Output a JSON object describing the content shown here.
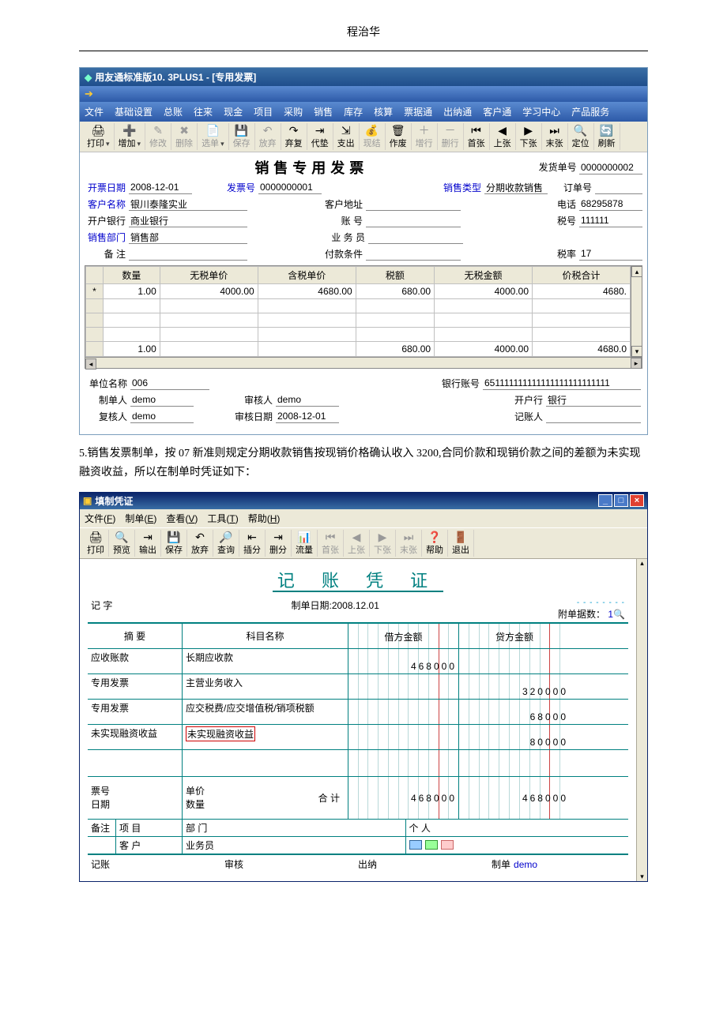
{
  "doc_header": "程治华",
  "win1": {
    "title": "用友通标准版10. 3PLUS1 - [专用发票]",
    "menu": [
      "文件",
      "基础设置",
      "总账",
      "往来",
      "现金",
      "项目",
      "采购",
      "销售",
      "库存",
      "核算",
      "票据通",
      "出纳通",
      "客户通",
      "学习中心",
      "产品服务"
    ],
    "toolbar": [
      {
        "id": "print",
        "label": "打印",
        "icon": "🖨",
        "enabled": true,
        "drop": true
      },
      {
        "id": "add",
        "label": "增加",
        "icon": "➕",
        "enabled": true,
        "drop": true
      },
      {
        "id": "edit",
        "label": "修改",
        "icon": "✎",
        "enabled": false
      },
      {
        "id": "del",
        "label": "删除",
        "icon": "✖",
        "enabled": false
      },
      {
        "id": "copy",
        "label": "选单",
        "icon": "📄",
        "enabled": false,
        "drop": true
      },
      {
        "id": "save",
        "label": "保存",
        "icon": "💾",
        "enabled": false
      },
      {
        "id": "undo",
        "label": "放弃",
        "icon": "↶",
        "enabled": false
      },
      {
        "id": "abandon",
        "label": "弃复",
        "icon": "↷",
        "enabled": true
      },
      {
        "id": "advance",
        "label": "代垫",
        "icon": "⇥",
        "enabled": true
      },
      {
        "id": "out",
        "label": "支出",
        "icon": "⇲",
        "enabled": true
      },
      {
        "id": "cash",
        "label": "现结",
        "icon": "💰",
        "enabled": false
      },
      {
        "id": "void",
        "label": "作废",
        "icon": "🗑",
        "enabled": true
      },
      {
        "id": "addrow",
        "label": "增行",
        "icon": "＋",
        "enabled": false
      },
      {
        "id": "delrow",
        "label": "删行",
        "icon": "－",
        "enabled": false
      },
      {
        "id": "first",
        "label": "首张",
        "icon": "⏮",
        "enabled": true
      },
      {
        "id": "prev",
        "label": "上张",
        "icon": "◀",
        "enabled": true
      },
      {
        "id": "next",
        "label": "下张",
        "icon": "▶",
        "enabled": true
      },
      {
        "id": "last",
        "label": "末张",
        "icon": "⏭",
        "enabled": true
      },
      {
        "id": "locate",
        "label": "定位",
        "icon": "🔍",
        "enabled": true
      },
      {
        "id": "refresh",
        "label": "刷新",
        "icon": "🔄",
        "enabled": true
      }
    ],
    "form_title": "销售专用发票",
    "labels": {
      "ship_no": "发货单号",
      "invoice_date": "开票日期",
      "invoice_no": "发票号",
      "sale_type": "销售类型",
      "order_no": "订单号",
      "cust_name": "客户名称",
      "cust_addr": "客户地址",
      "phone": "电话",
      "bank": "开户银行",
      "acct": "账    号",
      "tax_no": "税号",
      "dept": "销售部门",
      "clerk": "业 务 员",
      "remark": "备    注",
      "pay_cond": "付款条件",
      "tax_rate": "税率",
      "unit_name": "单位名称",
      "bank_acct": "银行账号",
      "maker": "制单人",
      "checker": "审核人",
      "open_bank": "开户行",
      "rechecker": "复核人",
      "check_date": "审核日期",
      "bookkeeper": "记账人"
    },
    "values": {
      "ship_no": "0000000002",
      "invoice_date": "2008-12-01",
      "invoice_no": "0000000001",
      "sale_type": "分期收款销售",
      "order_no": "",
      "cust_name": "银川泰隆实业",
      "cust_addr": "",
      "phone": "68295878",
      "bank": "商业银行",
      "acct": "",
      "tax_no": "111111",
      "dept": "销售部",
      "clerk": "",
      "remark": "",
      "pay_cond": "",
      "tax_rate": "17",
      "unit_name": "006",
      "bank_acct": "651111111111111111111111111",
      "maker": "demo",
      "checker": "demo",
      "open_bank": "银行",
      "rechecker": "demo",
      "check_date": "2008-12-01",
      "bookkeeper": ""
    },
    "grid": {
      "headers": [
        "数量",
        "无税单价",
        "含税单价",
        "税额",
        "无税金额",
        "价税合计"
      ],
      "row": {
        "qty": "1.00",
        "price": "4000.00",
        "price_tax": "4680.00",
        "tax": "680.00",
        "amt": "4000.00",
        "total": "4680."
      },
      "sum": {
        "qty": "1.00",
        "price": "",
        "price_tax": "",
        "tax": "680.00",
        "amt": "4000.00",
        "total": "4680.0"
      }
    }
  },
  "para": "5.销售发票制单，按 07 新准则规定分期收款销售按现销价格确认收入 3200,合同价款和现销价款之间的差额为未实现融资收益，所以在制单时凭证如下：",
  "win2": {
    "title": "填制凭证",
    "menu": [
      {
        "l": "文件",
        "k": "F"
      },
      {
        "l": "制单",
        "k": "E"
      },
      {
        "l": "查看",
        "k": "V"
      },
      {
        "l": "工具",
        "k": "T"
      },
      {
        "l": "帮助",
        "k": "H"
      }
    ],
    "toolbar": [
      {
        "id": "print",
        "label": "打印",
        "icon": "🖨",
        "enabled": true
      },
      {
        "id": "preview",
        "label": "预览",
        "icon": "🔍",
        "enabled": true
      },
      {
        "id": "output",
        "label": "输出",
        "icon": "⇥",
        "enabled": true
      },
      {
        "id": "save",
        "label": "保存",
        "icon": "💾",
        "enabled": true
      },
      {
        "id": "abandon",
        "label": "放弃",
        "icon": "↶",
        "enabled": true
      },
      {
        "id": "query",
        "label": "查询",
        "icon": "🔎",
        "enabled": true
      },
      {
        "id": "insert",
        "label": "插分",
        "icon": "⇤",
        "enabled": true
      },
      {
        "id": "delrow",
        "label": "删分",
        "icon": "⇥",
        "enabled": true
      },
      {
        "id": "flow",
        "label": "流量",
        "icon": "📊",
        "enabled": true
      },
      {
        "id": "first",
        "label": "首张",
        "icon": "⏮",
        "enabled": false
      },
      {
        "id": "prev",
        "label": "上张",
        "icon": "◀",
        "enabled": false
      },
      {
        "id": "next",
        "label": "下张",
        "icon": "▶",
        "enabled": false
      },
      {
        "id": "last",
        "label": "末张",
        "icon": "⏭",
        "enabled": false
      },
      {
        "id": "help",
        "label": "帮助",
        "icon": "❓",
        "enabled": true
      },
      {
        "id": "exit",
        "label": "退出",
        "icon": "🚪",
        "enabled": true
      }
    ],
    "voucher_title": "记 账 凭 证",
    "sub": {
      "left": "记  字",
      "mid_label": "制单日期:",
      "mid_value": "2008.12.01",
      "rt_label": "附单据数：",
      "rt_value": "1"
    },
    "headers": [
      "摘  要",
      "科目名称",
      "借方金额",
      "贷方金额"
    ],
    "entries": [
      {
        "zh": "应收账款",
        "km": "长期应收款",
        "dr": "468000",
        "cr": ""
      },
      {
        "zh": "专用发票",
        "km": "主营业务收入",
        "dr": "",
        "cr": "320000"
      },
      {
        "zh": "专用发票",
        "km": "应交税费/应交增值税/销项税额",
        "dr": "",
        "cr": "68000"
      },
      {
        "zh": "未实现融资收益",
        "km": "未实现融资收益",
        "dr": "",
        "cr": "80000",
        "red": true
      }
    ],
    "multi": {
      "l1": "票号",
      "l2": "日期",
      "c1": "单价",
      "c2": "数量",
      "hj": "合 计",
      "dr": "468000",
      "cr": "468000"
    },
    "remark": {
      "lbl": "备注",
      "r1a": "项  目",
      "r1b": "部  门",
      "r1c": "个    人",
      "r2a": "客  户",
      "r2b": "业务员"
    },
    "sig": {
      "a": "记账",
      "b": "审核",
      "c": "出纳",
      "d": "制单",
      "demo": "demo"
    }
  }
}
